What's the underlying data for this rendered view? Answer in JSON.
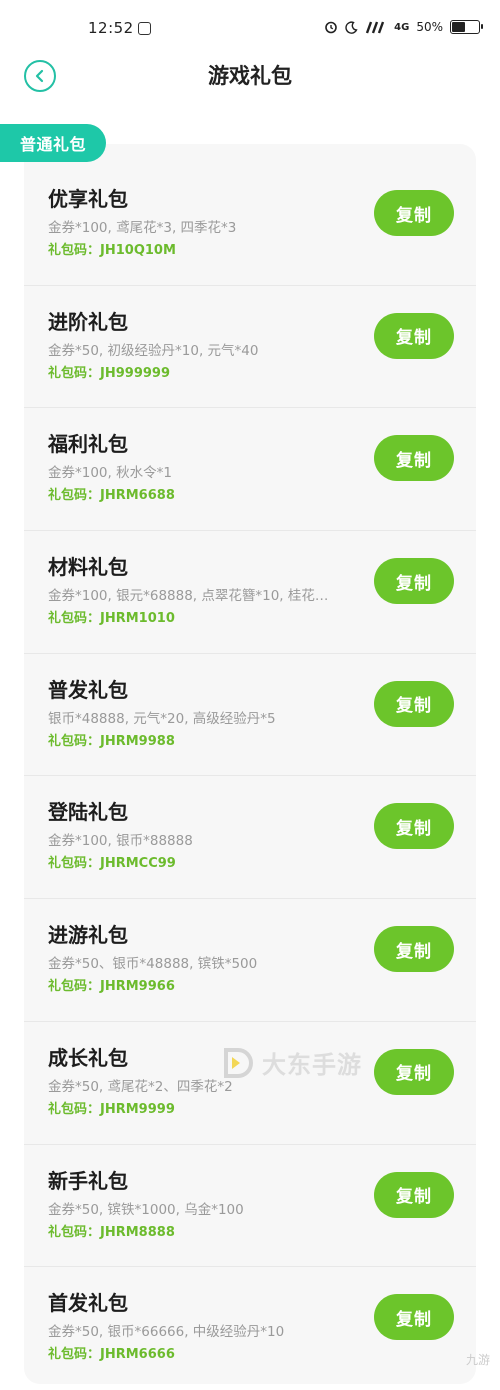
{
  "status_bar": {
    "time": "12:52",
    "network": "4G",
    "battery": "50%",
    "battery_level": 0.5
  },
  "header": {
    "title": "游戏礼包"
  },
  "section": {
    "label": "普通礼包"
  },
  "code_prefix": "礼包码：",
  "copy_label": "复制",
  "gifts": [
    {
      "name": "优享礼包",
      "desc": "金券*100, 鸢尾花*3, 四季花*3",
      "code": "JH10Q10M"
    },
    {
      "name": "进阶礼包",
      "desc": "金券*50, 初级经验丹*10, 元气*40",
      "code": "JH999999"
    },
    {
      "name": "福利礼包",
      "desc": "金券*100, 秋水令*1",
      "code": "JHRM6688"
    },
    {
      "name": "材料礼包",
      "desc": "金券*100, 银元*68888, 点翠花簪*10, 桂花…",
      "code": "JHRM1010"
    },
    {
      "name": "普发礼包",
      "desc": "银币*48888, 元气*20, 高级经验丹*5",
      "code": "JHRM9988"
    },
    {
      "name": "登陆礼包",
      "desc": "金券*100, 银币*88888",
      "code": "JHRMCC99"
    },
    {
      "name": "进游礼包",
      "desc": "金券*50、银币*48888, 镔铁*500",
      "code": "JHRM9966"
    },
    {
      "name": "成长礼包",
      "desc": "金券*50, 鸢尾花*2、四季花*2",
      "code": "JHRM9999"
    },
    {
      "name": "新手礼包",
      "desc": "金券*50, 镔铁*1000, 乌金*100",
      "code": "JHRM8888"
    },
    {
      "name": "首发礼包",
      "desc": "金券*50, 银币*66666, 中级经验丹*10",
      "code": "JHRM6666"
    }
  ],
  "watermark": {
    "text": "大东手游",
    "corner": "九游"
  },
  "colors": {
    "accent_teal": "#1ec8a8",
    "copy_green": "#6cc52b",
    "code_green": "#6cbb2d"
  },
  "icons": {
    "back": "back-arrow-circle-icon",
    "alarm": "alarm-icon",
    "moon": "moon-icon",
    "signal": "signal-icon",
    "battery": "battery-icon"
  }
}
